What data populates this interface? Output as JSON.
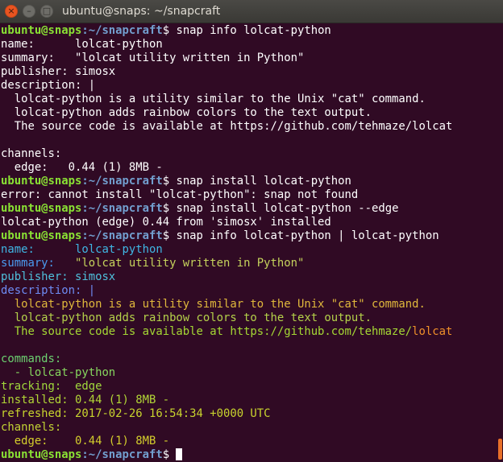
{
  "window": {
    "title": "ubuntu@snaps: ~/snapcraft",
    "close_glyph": "×",
    "minimize_glyph": "–",
    "maximize_glyph": "□"
  },
  "prompt": {
    "userhost": "ubuntu@snaps",
    "path": ":~/snapcraft",
    "symbol": "$ "
  },
  "colors": {
    "background": "#300A24",
    "prompt_user": "#8AE234",
    "prompt_path": "#729FCF",
    "text": "#FFFFFF",
    "close_button": "#E95420",
    "scroll_thumb": "#E8702A"
  },
  "terminal": {
    "lines": [
      {
        "type": "cmd",
        "text": "snap info lolcat-python"
      },
      {
        "type": "out",
        "segments": [
          {
            "text": "name:      lolcat-python"
          }
        ]
      },
      {
        "type": "out",
        "segments": [
          {
            "text": "summary:   \"lolcat utility written in Python\""
          }
        ]
      },
      {
        "type": "out",
        "segments": [
          {
            "text": "publisher: simosx"
          }
        ]
      },
      {
        "type": "out",
        "segments": [
          {
            "text": "description: |"
          }
        ]
      },
      {
        "type": "out",
        "segments": [
          {
            "text": "  lolcat-python is a utility similar to the Unix \"cat\" command."
          }
        ]
      },
      {
        "type": "out",
        "segments": [
          {
            "text": "  lolcat-python adds rainbow colors to the text output."
          }
        ]
      },
      {
        "type": "out",
        "segments": [
          {
            "text": "  The source code is available at https://github.com/tehmaze/lolcat"
          }
        ]
      },
      {
        "type": "out",
        "segments": [
          {
            "text": ""
          }
        ]
      },
      {
        "type": "out",
        "segments": [
          {
            "text": "channels:"
          }
        ]
      },
      {
        "type": "out",
        "segments": [
          {
            "text": "  edge:   0.44 (1) 8MB -"
          }
        ]
      },
      {
        "type": "cmd",
        "text": "snap install lolcat-python"
      },
      {
        "type": "out",
        "segments": [
          {
            "text": "error: cannot install \"lolcat-python\": snap not found"
          }
        ]
      },
      {
        "type": "cmd",
        "text": "snap install lolcat-python --edge"
      },
      {
        "type": "out",
        "segments": [
          {
            "text": "lolcat-python (edge) 0.44 from 'simosx' installed"
          }
        ]
      },
      {
        "type": "cmd",
        "text": "snap info lolcat-python | lolcat-python"
      },
      {
        "type": "out",
        "segments": [
          {
            "text": "name:      lolcat-python",
            "color": "#3FB6E4"
          }
        ]
      },
      {
        "type": "out",
        "segments": [
          {
            "text": "summary:   ",
            "color": "#4A9BF0"
          },
          {
            "text": "\"lolcat utility written in Python\"",
            "color": "#C5D35C"
          }
        ]
      },
      {
        "type": "out",
        "segments": [
          {
            "text": "publisher: simosx",
            "color": "#4FC0DC"
          }
        ]
      },
      {
        "type": "out",
        "segments": [
          {
            "text": "description: |",
            "color": "#6E8CF5"
          }
        ]
      },
      {
        "type": "out",
        "segments": [
          {
            "text": "  lolcat-python is a utility similar to the Unix \"cat\" command.",
            "color": "#E0B83C"
          }
        ]
      },
      {
        "type": "out",
        "segments": [
          {
            "text": "  lolcat-python adds rainbow colors to the text output.",
            "color": "#B5D24A"
          }
        ]
      },
      {
        "type": "out",
        "segments": [
          {
            "text": "  The source code is available at https://github.com/tehmaze/",
            "color": "#A5D834"
          },
          {
            "text": "lolcat",
            "color": "#F0902A"
          }
        ]
      },
      {
        "type": "out",
        "segments": [
          {
            "text": ""
          }
        ]
      },
      {
        "type": "out",
        "segments": [
          {
            "text": "commands:",
            "color": "#6CD070"
          }
        ]
      },
      {
        "type": "out",
        "segments": [
          {
            "text": "  - lolcat-python",
            "color": "#86D65E"
          }
        ]
      },
      {
        "type": "out",
        "segments": [
          {
            "text": "tracking:  edge",
            "color": "#A0D83C"
          }
        ]
      },
      {
        "type": "out",
        "segments": [
          {
            "text": "installed: 0.44 (1) 8MB -",
            "color": "#B2D636"
          }
        ]
      },
      {
        "type": "out",
        "segments": [
          {
            "text": "refreshed: 2017-02-26 16:54:34 +0000 UTC",
            "color": "#C8D42E"
          }
        ]
      },
      {
        "type": "out",
        "segments": [
          {
            "text": "channels:",
            "color": "#C2D234"
          }
        ]
      },
      {
        "type": "out",
        "segments": [
          {
            "text": "  edge:    0.44 (1) 8MB -",
            "color": "#D4CE2C"
          }
        ]
      },
      {
        "type": "cmd",
        "text": "",
        "cursor": true
      }
    ]
  }
}
